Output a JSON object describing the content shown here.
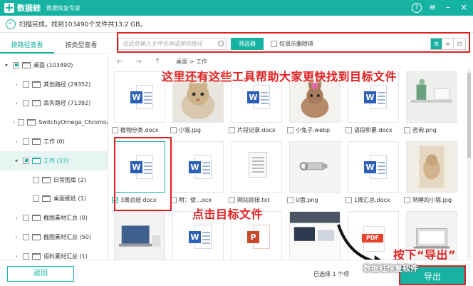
{
  "titlebar": {
    "app_name": "数据蛙",
    "app_subtitle": "数据恢复专家",
    "help_icon": "?",
    "menu_icon": "≡",
    "minimize_icon": "–",
    "close_icon": "×"
  },
  "status": {
    "text": "扫描完成。找到103490个文件共13.2 GB。"
  },
  "tabs": [
    {
      "label": "按路径查看",
      "active": true
    },
    {
      "label": "按类型查看",
      "active": false
    }
  ],
  "tree": [
    {
      "indent": 0,
      "chevron": "▾",
      "check": "partial",
      "label": "桌面 (103490)"
    },
    {
      "indent": 1,
      "chevron": "›",
      "check": "none",
      "label": "其他路径 (29352)"
    },
    {
      "indent": 1,
      "chevron": "›",
      "check": "none",
      "label": "丢失路径 (71392)"
    },
    {
      "indent": 1,
      "chevron": "›",
      "check": "none",
      "label": "SwitchyOmega_Chromium"
    },
    {
      "indent": 1,
      "chevron": "›",
      "check": "none",
      "label": "工作 (0)"
    },
    {
      "indent": 1,
      "chevron": "▾",
      "check": "partial",
      "label": "工作 (33)",
      "selected": true
    },
    {
      "indent": 2,
      "chevron": "",
      "check": "none",
      "label": "日常图库 (2)"
    },
    {
      "indent": 2,
      "chevron": "",
      "check": "none",
      "label": "桌面壁纸 (1)"
    },
    {
      "indent": 1,
      "chevron": "›",
      "check": "none",
      "label": "截图素材汇总 (0)"
    },
    {
      "indent": 1,
      "chevron": "›",
      "check": "none",
      "label": "截图素材汇总 (50)"
    },
    {
      "indent": 1,
      "chevron": "›",
      "check": "none",
      "label": "语料素材汇总 (1)"
    }
  ],
  "toolbar": {
    "search_placeholder": "在此处输入文件名称或保存路径",
    "filter_label": "筛选器",
    "deleted_only_label": "仅显示删除项",
    "view_modes": [
      "⊞",
      "≡",
      "⊟"
    ]
  },
  "nav": {
    "back": "←",
    "forward": "→",
    "up": "↑",
    "breadcrumb": "桌面 > 工作"
  },
  "files": [
    {
      "kind": "word",
      "name": "植物分类.docx",
      "checked": false
    },
    {
      "kind": "cat",
      "name": "小猫.jpg",
      "checked": false
    },
    {
      "kind": "word",
      "name": "片段记录.docx",
      "checked": false
    },
    {
      "kind": "rabbit",
      "name": "小兔子.webp",
      "checked": false
    },
    {
      "kind": "word",
      "name": "语段积累.docx",
      "checked": false
    },
    {
      "kind": "office",
      "name": "咨询.png",
      "checked": false
    },
    {
      "kind": "word",
      "name": "3周总结.docx",
      "checked": true,
      "selected": true
    },
    {
      "kind": "word",
      "name": "附：使…ocx",
      "checked": false
    },
    {
      "kind": "txt",
      "name": "网站链接.txt",
      "checked": false
    },
    {
      "kind": "usb",
      "name": "U盘.png",
      "checked": false
    },
    {
      "kind": "word",
      "name": "1周汇总.docx",
      "checked": false
    },
    {
      "kind": "cat2",
      "name": "熟睡的小猫.jpg",
      "checked": false
    },
    {
      "kind": "laptop",
      "name": "",
      "checked": false
    },
    {
      "kind": "word",
      "name": "",
      "checked": false
    },
    {
      "kind": "ppt",
      "name": "",
      "checked": false
    },
    {
      "kind": "desk",
      "name": "",
      "checked": false
    },
    {
      "kind": "pdf",
      "name": "",
      "checked": false
    },
    {
      "kind": "laptop2",
      "name": "",
      "checked": false
    }
  ],
  "annotations": {
    "top": "这里还有这些工具帮助大家更快找到目标文件",
    "middle": "点击目标文件",
    "bottom": "按下“导出”"
  },
  "bottom": {
    "back_label": "返回",
    "selection_info": "已选择 1 个项",
    "export_label": "导出",
    "watermark": "数据蛙恢复软件"
  },
  "colors": {
    "accent": "#16b3a3",
    "annotation": "#e02020",
    "word_blue": "#2b5fb8",
    "ppt_orange": "#c9482a",
    "pdf_red": "#e8412a"
  },
  "icons": {
    "word_letter": "W",
    "ppt_letter": "P",
    "pdf_label": "PDF",
    "check_mark": "✓"
  }
}
